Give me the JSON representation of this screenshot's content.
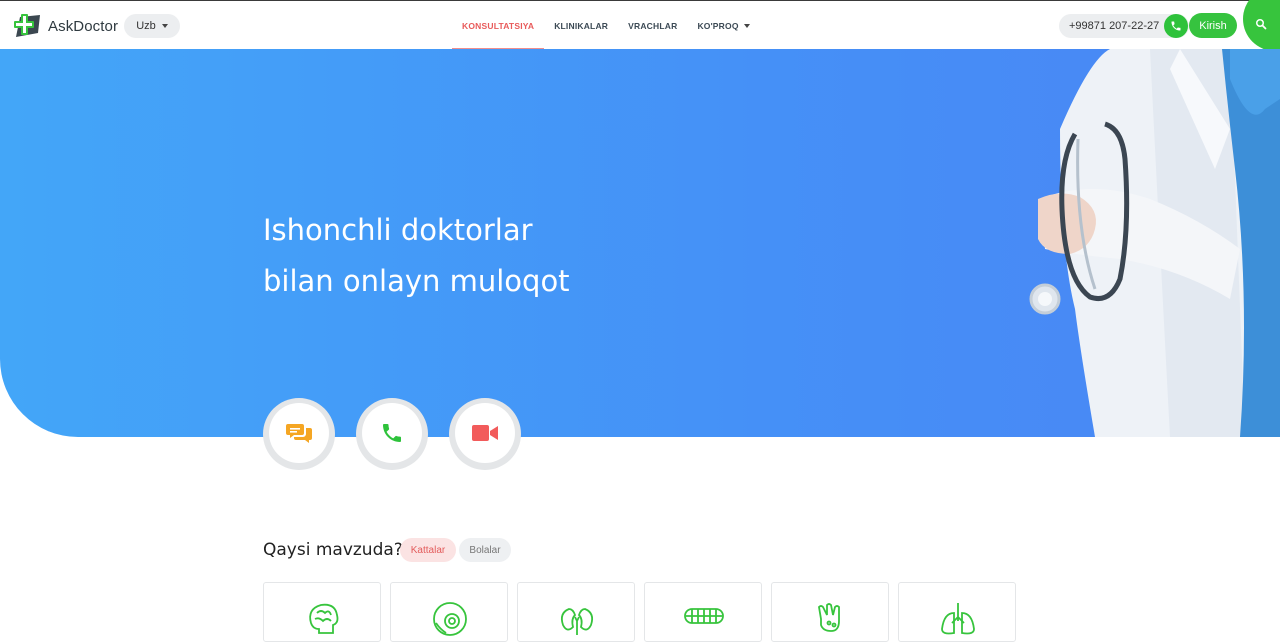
{
  "header": {
    "brand": "AskDoctor",
    "language": "Uzb",
    "nav": [
      "KONSULTATSIYA",
      "KLINIKALAR",
      "VRACHLAR",
      "KO'PROQ"
    ],
    "phone": "+99871 207-22-27",
    "login_label": "Kirish",
    "icons": {
      "phone": "phone-icon",
      "search": "search-icon"
    },
    "colors": {
      "accent_green": "#37c43d",
      "nav_active": "#e85a5a"
    }
  },
  "hero": {
    "title_line1": "Ishonchli doktorlar",
    "title_line2": "bilan onlayn muloqot",
    "gradient": [
      "#43a6f8",
      "#4a86f4"
    ]
  },
  "consultation_types": [
    {
      "icon": "chat-icon",
      "color": "#f5a623"
    },
    {
      "icon": "phone-icon",
      "color": "#2ec23b"
    },
    {
      "icon": "video-camera-icon",
      "color": "#f25b5b"
    }
  ],
  "topics": {
    "title": "Qaysi mavzuda?",
    "chips": [
      "Kattalar",
      "Bolalar"
    ],
    "active_chip": "Kattalar",
    "categories": [
      "brain-icon",
      "eye-icon",
      "kidneys-icon",
      "teeth-icon",
      "hand-icon",
      "lungs-icon"
    ]
  }
}
